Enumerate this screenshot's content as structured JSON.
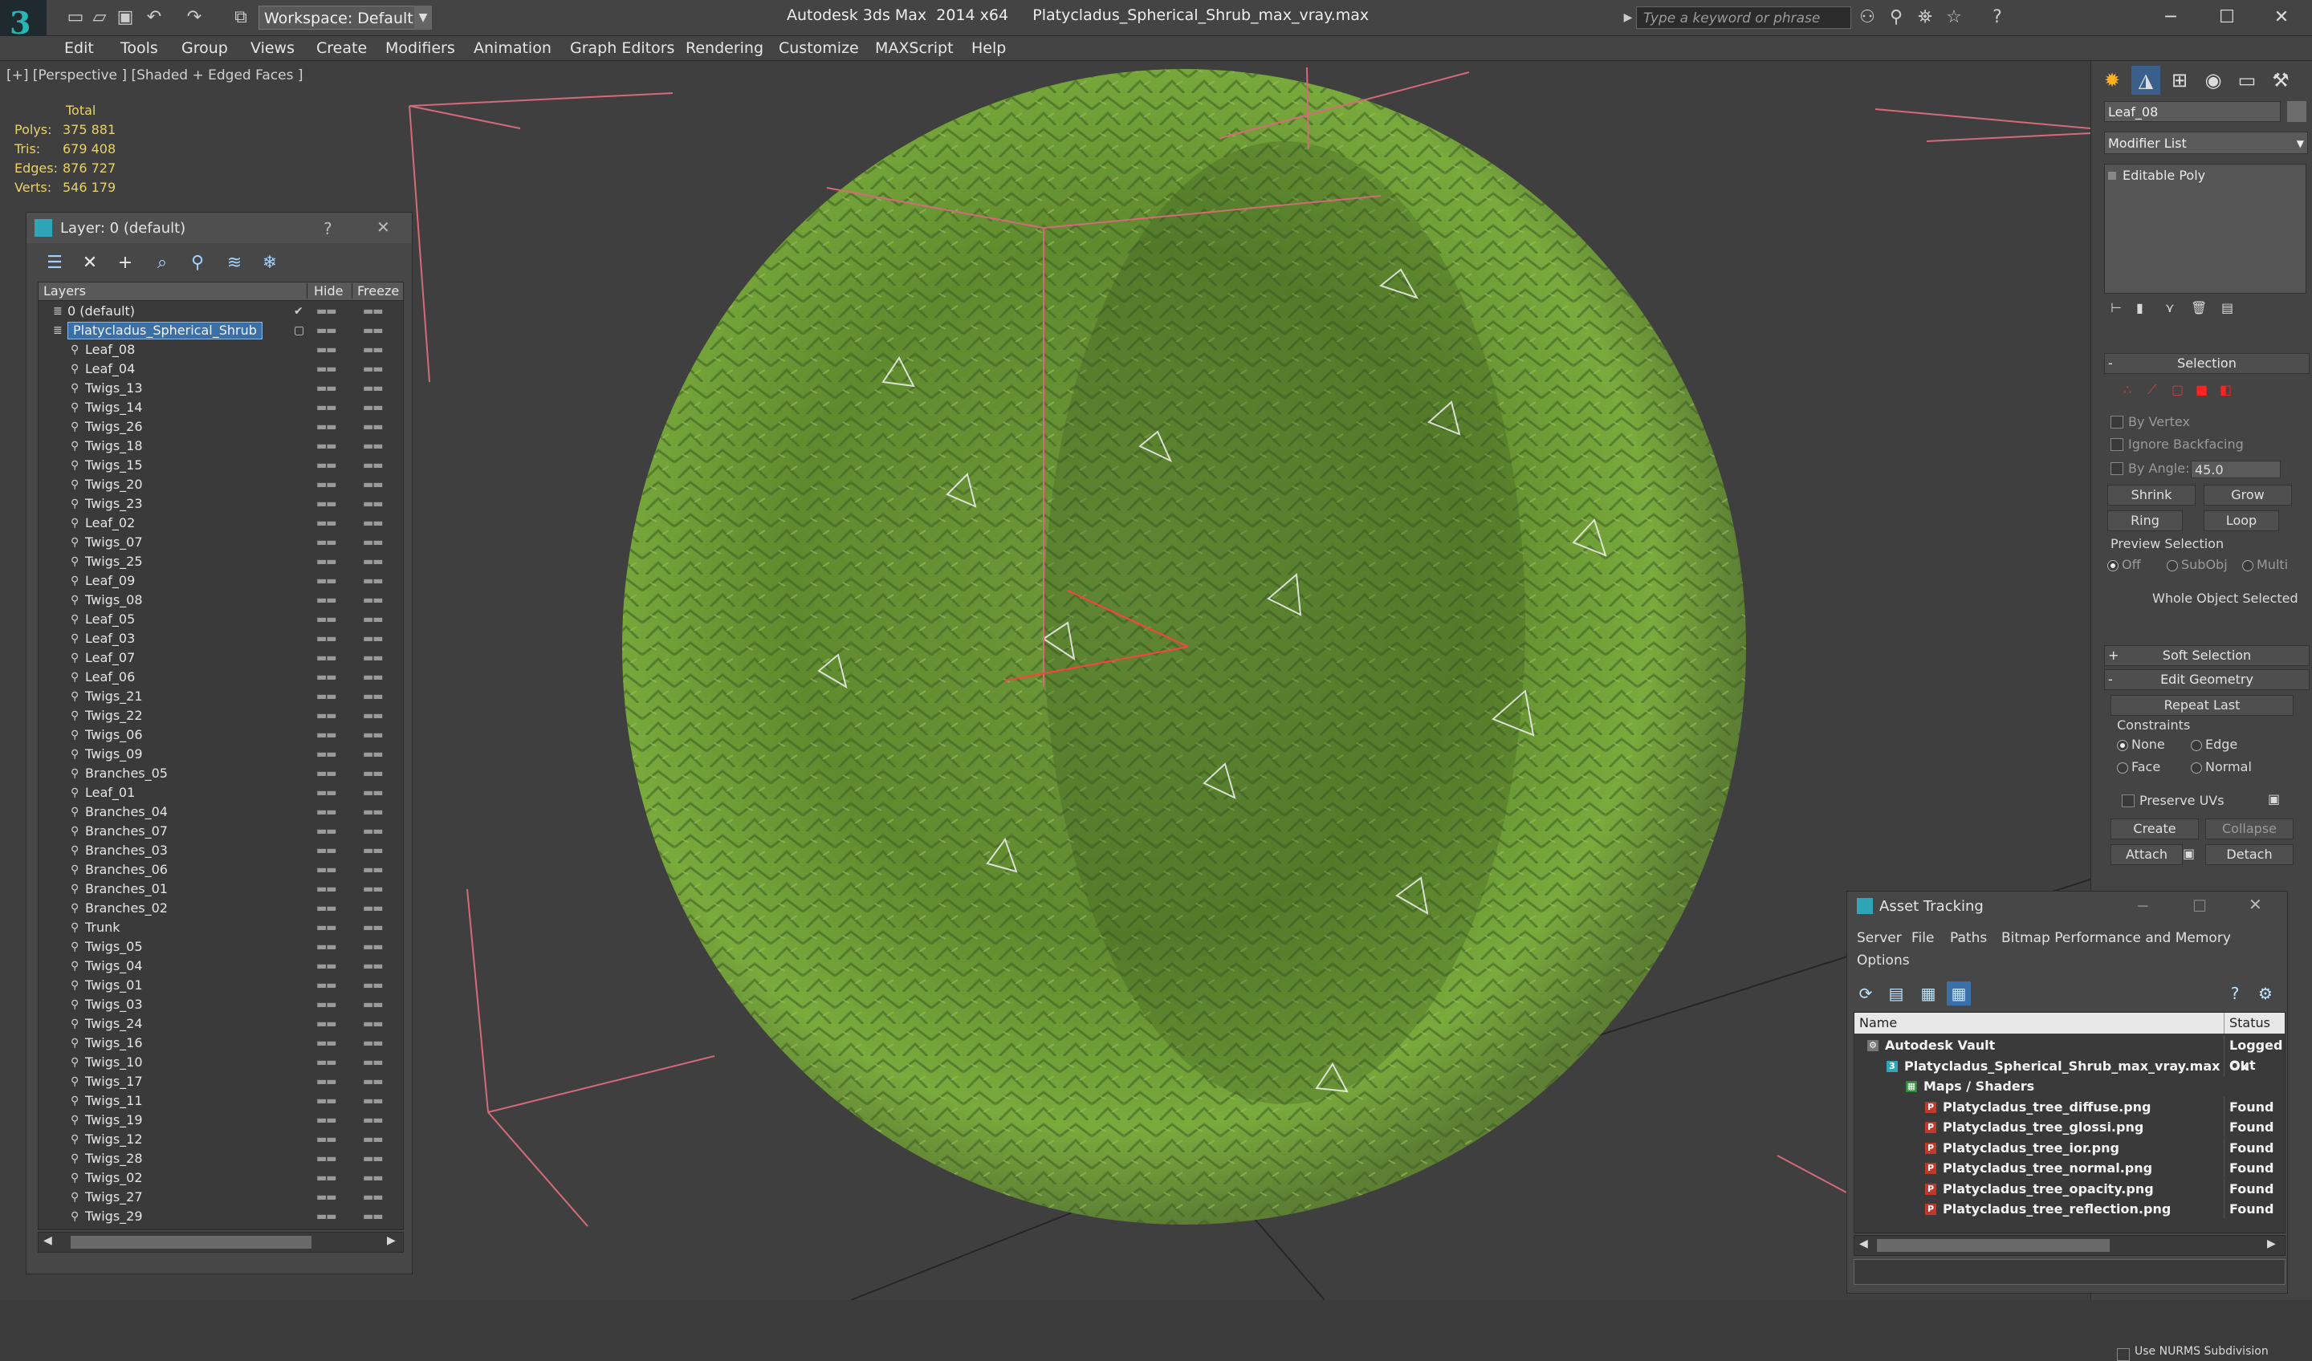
{
  "titlebar": {
    "workspace": "Workspace: Default",
    "app_name": "Autodesk 3ds Max  2014 x64",
    "file_name": "Platycladus_Spherical_Shrub_max_vray.max",
    "search_placeholder": "Type a keyword or phrase"
  },
  "menu": [
    "Edit",
    "Tools",
    "Group",
    "Views",
    "Create",
    "Modifiers",
    "Animation",
    "Graph Editors",
    "Rendering",
    "Customize",
    "MAXScript",
    "Help"
  ],
  "viewport": {
    "label": "[+] [Perspective ] [Shaded + Edged Faces ]",
    "stats_header": "Total",
    "stats": [
      {
        "label": "Polys:",
        "value": "375 881"
      },
      {
        "label": "Tris:",
        "value": "679 408"
      },
      {
        "label": "Edges:",
        "value": "876 727"
      },
      {
        "label": "Verts:",
        "value": "546 179"
      }
    ],
    "colors": {
      "foliage_light": "#7aa83a",
      "foliage_dark": "#3c5e22",
      "gizmo": "#d46a7a"
    }
  },
  "layer_dialog": {
    "title": "Layer: 0 (default)",
    "help": "?",
    "close": "✕",
    "columns": {
      "layers": "Layers",
      "hide": "Hide",
      "freeze": "Freeze"
    },
    "rows": [
      {
        "name": "0 (default)",
        "level": 0,
        "kind": "layer",
        "checked": true
      },
      {
        "name": "Platycladus_Spherical_Shrub",
        "level": 0,
        "kind": "layer",
        "selected": true
      },
      {
        "name": "Leaf_08",
        "level": 1
      },
      {
        "name": "Leaf_04",
        "level": 1
      },
      {
        "name": "Twigs_13",
        "level": 1
      },
      {
        "name": "Twigs_14",
        "level": 1
      },
      {
        "name": "Twigs_26",
        "level": 1
      },
      {
        "name": "Twigs_18",
        "level": 1
      },
      {
        "name": "Twigs_15",
        "level": 1
      },
      {
        "name": "Twigs_20",
        "level": 1
      },
      {
        "name": "Twigs_23",
        "level": 1
      },
      {
        "name": "Leaf_02",
        "level": 1
      },
      {
        "name": "Twigs_07",
        "level": 1
      },
      {
        "name": "Twigs_25",
        "level": 1
      },
      {
        "name": "Leaf_09",
        "level": 1
      },
      {
        "name": "Twigs_08",
        "level": 1
      },
      {
        "name": "Leaf_05",
        "level": 1
      },
      {
        "name": "Leaf_03",
        "level": 1
      },
      {
        "name": "Leaf_07",
        "level": 1
      },
      {
        "name": "Leaf_06",
        "level": 1
      },
      {
        "name": "Twigs_21",
        "level": 1
      },
      {
        "name": "Twigs_22",
        "level": 1
      },
      {
        "name": "Twigs_06",
        "level": 1
      },
      {
        "name": "Twigs_09",
        "level": 1
      },
      {
        "name": "Branches_05",
        "level": 1
      },
      {
        "name": "Leaf_01",
        "level": 1
      },
      {
        "name": "Branches_04",
        "level": 1
      },
      {
        "name": "Branches_07",
        "level": 1
      },
      {
        "name": "Branches_03",
        "level": 1
      },
      {
        "name": "Branches_06",
        "level": 1
      },
      {
        "name": "Branches_01",
        "level": 1
      },
      {
        "name": "Branches_02",
        "level": 1
      },
      {
        "name": "Trunk",
        "level": 1
      },
      {
        "name": "Twigs_05",
        "level": 1
      },
      {
        "name": "Twigs_04",
        "level": 1
      },
      {
        "name": "Twigs_01",
        "level": 1
      },
      {
        "name": "Twigs_03",
        "level": 1
      },
      {
        "name": "Twigs_24",
        "level": 1
      },
      {
        "name": "Twigs_16",
        "level": 1
      },
      {
        "name": "Twigs_10",
        "level": 1
      },
      {
        "name": "Twigs_17",
        "level": 1
      },
      {
        "name": "Twigs_11",
        "level": 1
      },
      {
        "name": "Twigs_19",
        "level": 1
      },
      {
        "name": "Twigs_12",
        "level": 1
      },
      {
        "name": "Twigs_28",
        "level": 1
      },
      {
        "name": "Twigs_02",
        "level": 1
      },
      {
        "name": "Twigs_27",
        "level": 1
      },
      {
        "name": "Twigs_29",
        "level": 1
      },
      {
        "name": "Platycladus_Spherical_Shrub",
        "level": 1
      }
    ]
  },
  "command_panel": {
    "object_name": "Leaf_08",
    "modifier_list": "Modifier List",
    "stack_item": "Editable Poly",
    "selection": {
      "header": "Selection",
      "by_vertex": "By Vertex",
      "ignore_backfacing": "Ignore Backfacing",
      "by_angle": "By Angle:",
      "angle_value": "45.0",
      "shrink": "Shrink",
      "grow": "Grow",
      "ring": "Ring",
      "loop": "Loop",
      "preview_selection": "Preview Selection",
      "off": "Off",
      "subobj": "SubObj",
      "multi": "Multi",
      "status": "Whole Object Selected"
    },
    "soft_selection": "Soft Selection",
    "edit_geometry": {
      "header": "Edit Geometry",
      "repeat_last": "Repeat Last",
      "constraints": "Constraints",
      "none": "None",
      "edge": "Edge",
      "face": "Face",
      "normal": "Normal",
      "preserve_uvs": "Preserve UVs",
      "create": "Create",
      "collapse": "Collapse",
      "attach": "Attach",
      "detach": "Detach"
    },
    "nurms": "Use NURMS Subdivision"
  },
  "asset_tracking": {
    "title": "Asset Tracking",
    "menu": [
      "Server",
      "File",
      "Paths",
      "Bitmap Performance and Memory"
    ],
    "options": "Options",
    "columns": {
      "name": "Name",
      "status": "Status"
    },
    "rows": [
      {
        "name": "Autodesk Vault",
        "status": "Logged Out",
        "level": 0,
        "icon": "vault"
      },
      {
        "name": "Platycladus_Spherical_Shrub_max_vray.max",
        "status": "Ok",
        "level": 1,
        "icon": "max"
      },
      {
        "name": "Maps / Shaders",
        "status": "",
        "level": 2,
        "icon": "maps"
      },
      {
        "name": "Platycladus_tree_diffuse.png",
        "status": "Found",
        "level": 3,
        "icon": "png"
      },
      {
        "name": "Platycladus_tree_glossi.png",
        "status": "Found",
        "level": 3,
        "icon": "png"
      },
      {
        "name": "Platycladus_tree_ior.png",
        "status": "Found",
        "level": 3,
        "icon": "png"
      },
      {
        "name": "Platycladus_tree_normal.png",
        "status": "Found",
        "level": 3,
        "icon": "png"
      },
      {
        "name": "Platycladus_tree_opacity.png",
        "status": "Found",
        "level": 3,
        "icon": "png"
      },
      {
        "name": "Platycladus_tree_reflection.png",
        "status": "Found",
        "level": 3,
        "icon": "png"
      }
    ]
  }
}
